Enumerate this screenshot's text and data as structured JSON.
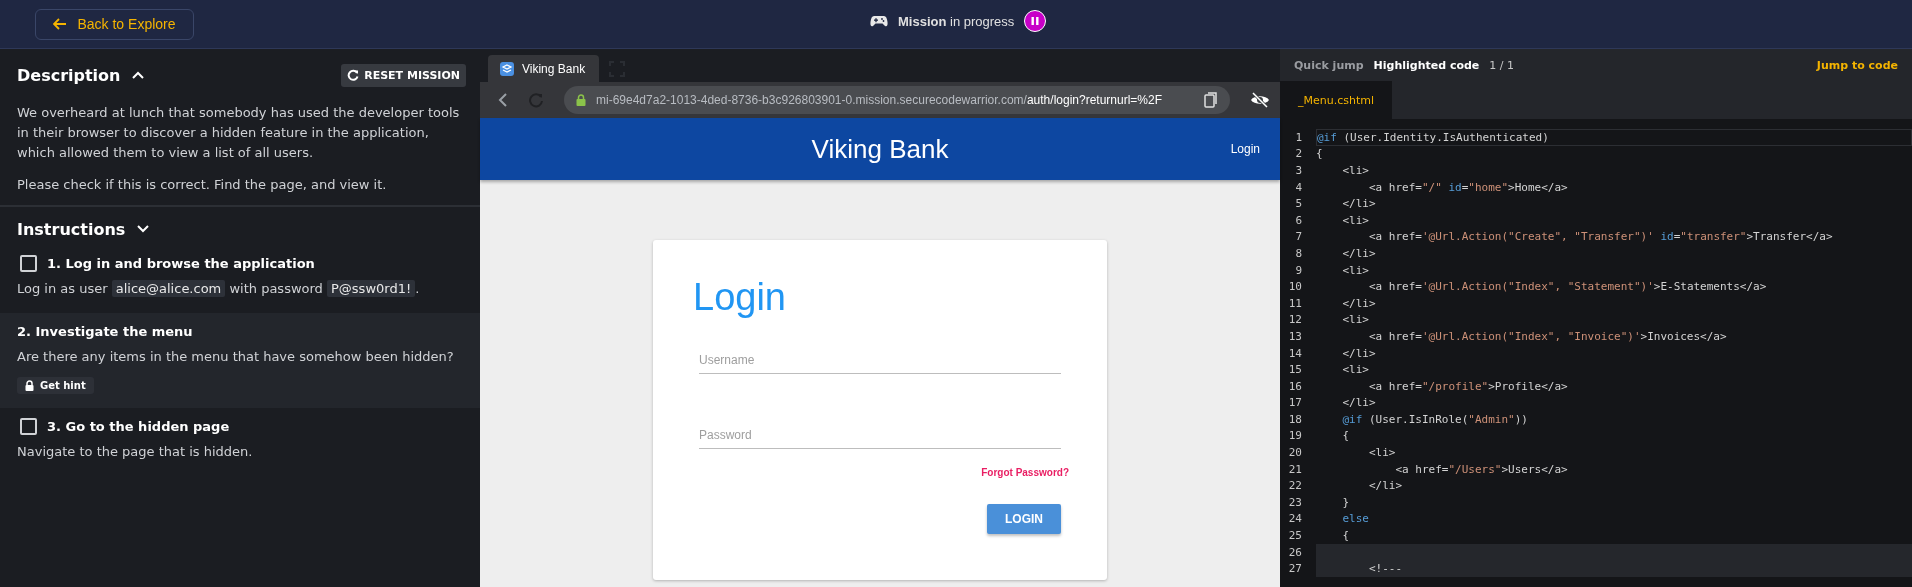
{
  "top_bar": {
    "back_button": "Back to Explore",
    "status_bold": "Mission",
    "status_rest": "in progress",
    "paused": false
  },
  "description": {
    "title": "Description",
    "expanded": true,
    "reset_button": "RESET MISSION",
    "paragraphs": [
      "We overheard at lunch that somebody has used the developer tools in their browser to discover a hidden feature in the application, which allowed them to view a list of all users.",
      "Please check if this is correct. Find the page, and view it."
    ]
  },
  "instructions": {
    "title": "Instructions",
    "expanded": true,
    "steps": [
      {
        "kind": "checkbox",
        "title": "1. Log in and browse the application",
        "checked": false,
        "selected": false,
        "parts": [
          {
            "kind": "text",
            "text": "Log in as user"
          },
          {
            "kind": "code",
            "text": "alice@alice.com"
          },
          {
            "kind": "text",
            "text": "with password"
          },
          {
            "kind": "code",
            "text": "P@ssw0rd1!"
          },
          {
            "kind": "text",
            "text": "."
          }
        ]
      },
      {
        "kind": "hint",
        "title": "2. Investigate the menu",
        "selected": true,
        "parts": [
          {
            "kind": "text",
            "text": "Are there any items in the menu that have somehow been hidden?"
          }
        ],
        "hint_button": "Get hint"
      },
      {
        "kind": "checkbox",
        "title": "3. Go to the hidden page",
        "checked": false,
        "selected": false,
        "parts": [
          {
            "kind": "text",
            "text": "Navigate to the page that is hidden."
          }
        ]
      }
    ]
  },
  "browser": {
    "tab": "Viking Bank",
    "url_host": "mi-69e4d7a2-1013-4ded-8736-b3c926803901-0.mission.securecodewarrior.com/",
    "url_path": "auth/login?returnurl=%2F",
    "site": {
      "brand": "Viking Bank",
      "nav_link": "Login",
      "card_title": "Login",
      "fields": [
        {
          "placeholder": "Username"
        },
        {
          "placeholder": "Password"
        }
      ],
      "forgot_link": "Forgot Password?",
      "login_button": "LOGIN"
    }
  },
  "code_panel": {
    "quick_jump": "Quick jump",
    "highlighted_label": "Highlighted code",
    "count": "1 / 1",
    "jump_link": "Jump to code",
    "file_tab": "_Menu.cshtml",
    "lines": [
      {
        "number": "1",
        "current": true,
        "highlighted": false,
        "tokens": [
          {
            "kind": "keyword",
            "text": "@if"
          },
          {
            "kind": "plain",
            "text": " (User.Identity.IsAuthenticated)"
          }
        ]
      },
      {
        "number": "2",
        "current": false,
        "highlighted": false,
        "tokens": [
          {
            "kind": "plain",
            "text": "{"
          }
        ]
      },
      {
        "number": "3",
        "current": false,
        "highlighted": false,
        "tokens": [
          {
            "kind": "plain",
            "text": "    <li>"
          }
        ]
      },
      {
        "number": "4",
        "current": false,
        "highlighted": false,
        "tokens": [
          {
            "kind": "plain",
            "text": "        <a href="
          },
          {
            "kind": "string",
            "text": "\"/\" "
          },
          {
            "kind": "keyword",
            "text": "id"
          },
          {
            "kind": "plain",
            "text": "="
          },
          {
            "kind": "string",
            "text": "\"home\""
          },
          {
            "kind": "plain",
            "text": ">Home</a>"
          }
        ]
      },
      {
        "number": "5",
        "current": false,
        "highlighted": false,
        "tokens": [
          {
            "kind": "plain",
            "text": "    </li>"
          }
        ]
      },
      {
        "number": "6",
        "current": false,
        "highlighted": false,
        "tokens": [
          {
            "kind": "plain",
            "text": "    <li>"
          }
        ]
      },
      {
        "number": "7",
        "current": false,
        "highlighted": false,
        "tokens": [
          {
            "kind": "plain",
            "text": "        <a href="
          },
          {
            "kind": "string",
            "text": "'@Url.Action(\"Create\", \"Transfer\")' "
          },
          {
            "kind": "keyword",
            "text": "id"
          },
          {
            "kind": "plain",
            "text": "="
          },
          {
            "kind": "string",
            "text": "\"transfer\""
          },
          {
            "kind": "plain",
            "text": ">Transfer</a>"
          }
        ]
      },
      {
        "number": "8",
        "current": false,
        "highlighted": false,
        "tokens": [
          {
            "kind": "plain",
            "text": "    </li>"
          }
        ]
      },
      {
        "number": "9",
        "current": false,
        "highlighted": false,
        "tokens": [
          {
            "kind": "plain",
            "text": "    <li>"
          }
        ]
      },
      {
        "number": "10",
        "current": false,
        "highlighted": false,
        "tokens": [
          {
            "kind": "plain",
            "text": "        <a href="
          },
          {
            "kind": "string",
            "text": "'@Url.Action(\"Index\", \"Statement\")'"
          },
          {
            "kind": "plain",
            "text": ">E-Statements</a>"
          }
        ]
      },
      {
        "number": "11",
        "current": false,
        "highlighted": false,
        "tokens": [
          {
            "kind": "plain",
            "text": "    </li>"
          }
        ]
      },
      {
        "number": "12",
        "current": false,
        "highlighted": false,
        "tokens": [
          {
            "kind": "plain",
            "text": "    <li>"
          }
        ]
      },
      {
        "number": "13",
        "current": false,
        "highlighted": false,
        "tokens": [
          {
            "kind": "plain",
            "text": "        <a href="
          },
          {
            "kind": "string",
            "text": "'@Url.Action(\"Index\", \"Invoice\")'"
          },
          {
            "kind": "plain",
            "text": ">Invoices</a>"
          }
        ]
      },
      {
        "number": "14",
        "current": false,
        "highlighted": false,
        "tokens": [
          {
            "kind": "plain",
            "text": "    </li>"
          }
        ]
      },
      {
        "number": "15",
        "current": false,
        "highlighted": false,
        "tokens": [
          {
            "kind": "plain",
            "text": "    <li>"
          }
        ]
      },
      {
        "number": "16",
        "current": false,
        "highlighted": false,
        "tokens": [
          {
            "kind": "plain",
            "text": "        <a href="
          },
          {
            "kind": "string",
            "text": "\"/profile\""
          },
          {
            "kind": "plain",
            "text": ">Profile</a>"
          }
        ]
      },
      {
        "number": "17",
        "current": false,
        "highlighted": false,
        "tokens": [
          {
            "kind": "plain",
            "text": "    </li>"
          }
        ]
      },
      {
        "number": "18",
        "current": false,
        "highlighted": false,
        "tokens": [
          {
            "kind": "keyword",
            "text": "    @if"
          },
          {
            "kind": "plain",
            "text": " (User.IsInRole("
          },
          {
            "kind": "string",
            "text": "\"Admin\""
          },
          {
            "kind": "plain",
            "text": "))"
          }
        ]
      },
      {
        "number": "19",
        "current": false,
        "highlighted": false,
        "tokens": [
          {
            "kind": "plain",
            "text": "    {"
          }
        ]
      },
      {
        "number": "20",
        "current": false,
        "highlighted": false,
        "tokens": [
          {
            "kind": "plain",
            "text": "        <li>"
          }
        ]
      },
      {
        "number": "21",
        "current": false,
        "highlighted": false,
        "tokens": [
          {
            "kind": "plain",
            "text": "            <a href="
          },
          {
            "kind": "string",
            "text": "\"/Users\""
          },
          {
            "kind": "plain",
            "text": ">Users</a>"
          }
        ]
      },
      {
        "number": "22",
        "current": false,
        "highlighted": false,
        "tokens": [
          {
            "kind": "plain",
            "text": "        </li>"
          }
        ]
      },
      {
        "number": "23",
        "current": false,
        "highlighted": false,
        "tokens": [
          {
            "kind": "plain",
            "text": "    }"
          }
        ]
      },
      {
        "number": "24",
        "current": false,
        "highlighted": false,
        "tokens": [
          {
            "kind": "keyword",
            "text": "    else"
          }
        ]
      },
      {
        "number": "25",
        "current": false,
        "highlighted": false,
        "tokens": [
          {
            "kind": "plain",
            "text": "    {"
          }
        ]
      },
      {
        "number": "26",
        "current": false,
        "highlighted": true
      },
      {
        "number": "27",
        "current": false,
        "highlighted": true,
        "tokens": [
          {
            "kind": "plain",
            "text": "        <!---"
          }
        ]
      }
    ]
  }
}
